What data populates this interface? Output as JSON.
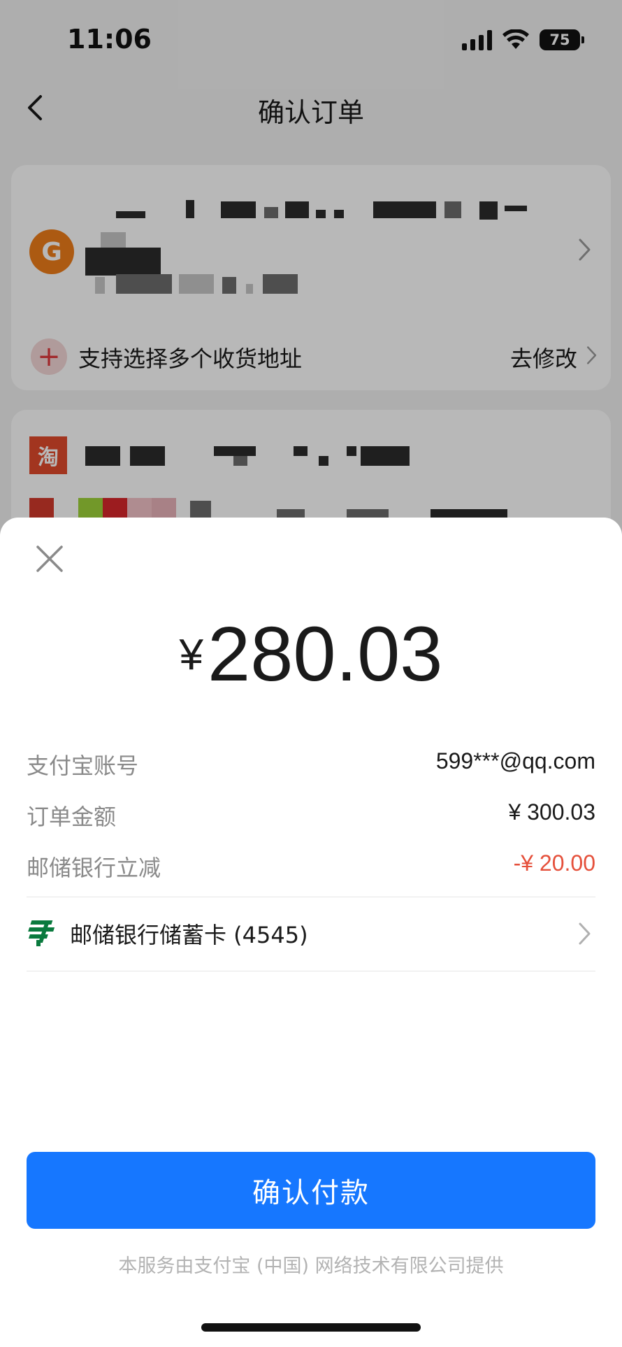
{
  "status_bar": {
    "time": "11:06",
    "battery": "75",
    "icons": [
      "signal-icon",
      "wifi-icon",
      "battery-icon"
    ]
  },
  "nav": {
    "title": "确认订单",
    "back_icon": "chevron-left-icon"
  },
  "address_card": {
    "merchant_icon": "merchant-logo",
    "tip": "支持选择多个收货地址",
    "edit_label": "去修改"
  },
  "shop_card": {
    "shop_logo_text": "淘"
  },
  "pay_sheet": {
    "close_icon": "close-icon",
    "currency": "¥",
    "amount": "280.03",
    "details": [
      {
        "label": "支付宝账号",
        "value": "599***@qq.com"
      },
      {
        "label": "订单金额",
        "value": "¥ 300.03"
      },
      {
        "label": "邮储银行立减",
        "value": "-¥ 20.00"
      }
    ],
    "pay_method": "邮储银行储蓄卡 (4545)",
    "confirm_label": "确认付款",
    "provider_note": "本服务由支付宝 (中国) 网络技术有限公司提供"
  },
  "colors": {
    "primary_button": "#1677ff",
    "discount": "#e5503b",
    "bank_green": "#0a7a3e",
    "merchant_orange": "#ef7d1a"
  }
}
